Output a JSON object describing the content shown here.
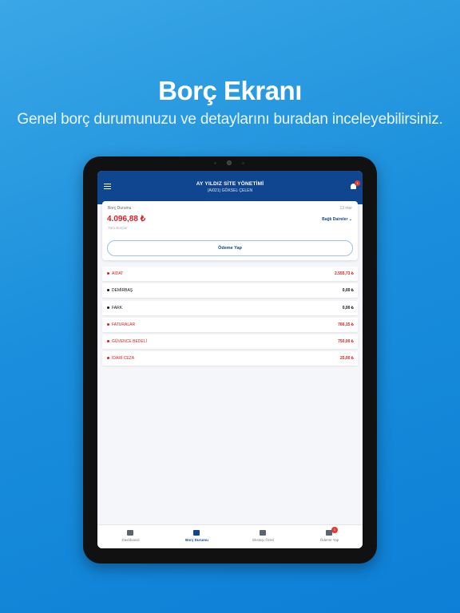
{
  "promo": {
    "headline": "Borç Ekranı",
    "subline": "Genel borç durumunuzu ve detaylarını buradan inceleyebilirsiniz."
  },
  "appbar": {
    "title": "AY YILDIZ SİTE YÖNETİMİ",
    "subtitle": "(A/021) GÖKSEL ÇELEN",
    "notification_count": "1"
  },
  "summary": {
    "label": "Borç Durumu",
    "date": "13 mar",
    "amount": "4.096,88 ₺",
    "caption": "Tüm Borçlar",
    "filter_label": "Bağlı Daireler ⌄",
    "pay_button": "Ödeme Yap"
  },
  "items": [
    {
      "label": "AİDAT",
      "value": "2.555,73 ₺",
      "color": "#d32027"
    },
    {
      "label": "DEMİRBAŞ",
      "value": "0,00 ₺",
      "color": "#111111"
    },
    {
      "label": "FARK",
      "value": "0,00 ₺",
      "color": "#111111"
    },
    {
      "label": "FATURALAR",
      "value": "766,15 ₺",
      "color": "#d32027"
    },
    {
      "label": "GÜVENCE BEDELİ",
      "value": "750,00 ₺",
      "color": "#d32027"
    },
    {
      "label": "İDARİ CEZA",
      "value": "25,00 ₺",
      "color": "#d32027"
    }
  ],
  "tabs": [
    {
      "label": "Dashboard",
      "icon": "dashboard-icon",
      "active": false
    },
    {
      "label": "Borç Durumu",
      "icon": "debt-chart-icon",
      "active": true
    },
    {
      "label": "Ekstaşı Özeti",
      "icon": "wallet-icon",
      "active": false
    },
    {
      "label": "Ödeme Yap",
      "icon": "payment-icon",
      "active": false,
      "badge": "1"
    }
  ],
  "colors": {
    "primary": "#10468f",
    "danger": "#d32027"
  }
}
